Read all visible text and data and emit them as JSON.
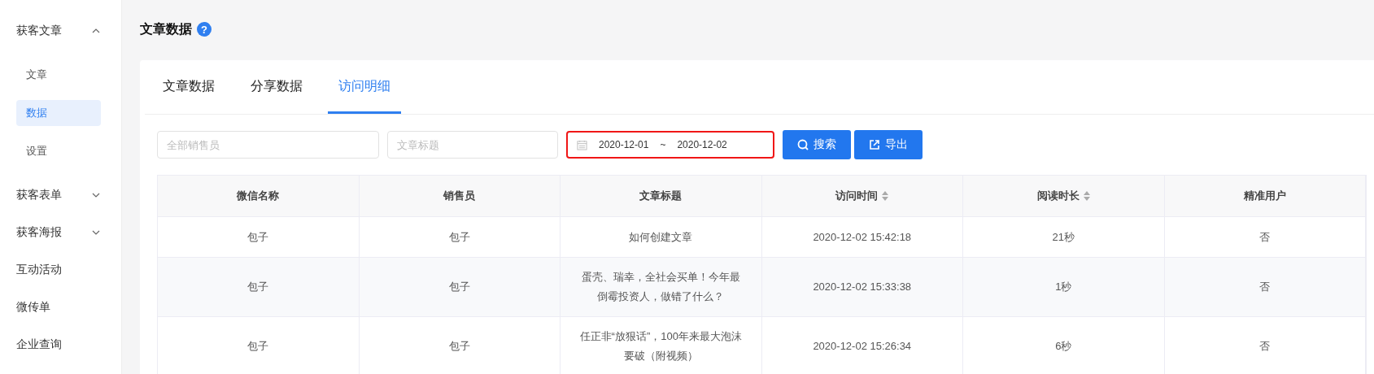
{
  "sidebar": {
    "items": [
      {
        "label": "获客文章",
        "expanded": true,
        "children": [
          {
            "label": "文章",
            "selected": false
          },
          {
            "label": "数据",
            "selected": true
          },
          {
            "label": "设置",
            "selected": false
          }
        ]
      },
      {
        "label": "获客表单",
        "expanded": false
      },
      {
        "label": "获客海报",
        "expanded": false
      },
      {
        "label": "互动活动"
      },
      {
        "label": "微传单"
      },
      {
        "label": "企业查询"
      }
    ]
  },
  "page": {
    "title": "文章数据",
    "help_icon": "?"
  },
  "tabs": [
    {
      "label": "文章数据",
      "selected": false
    },
    {
      "label": "分享数据",
      "selected": false
    },
    {
      "label": "访问明细",
      "selected": true
    }
  ],
  "filters": {
    "salesperson": {
      "placeholder": "全部销售员"
    },
    "article_title": {
      "placeholder": "文章标题"
    },
    "date_range": {
      "start": "2020-12-01",
      "separator": "~",
      "end": "2020-12-02",
      "highlighted": true
    },
    "search_button": "搜索",
    "export_button": "导出"
  },
  "table": {
    "columns": [
      {
        "label": "微信名称",
        "sortable": false
      },
      {
        "label": "销售员",
        "sortable": false
      },
      {
        "label": "文章标题",
        "sortable": false
      },
      {
        "label": "访问时间",
        "sortable": true
      },
      {
        "label": "阅读时长",
        "sortable": true
      },
      {
        "label": "精准用户",
        "sortable": false
      }
    ],
    "rows": [
      [
        "包子",
        "包子",
        "如何创建文章",
        "2020-12-02 15:42:18",
        "21秒",
        "否"
      ],
      [
        "包子",
        "包子",
        "蛋壳、瑞幸，全社会买单！今年最倒霉投资人，做错了什么？",
        "2020-12-02 15:33:38",
        "1秒",
        "否"
      ],
      [
        "包子",
        "包子",
        "任正非“放狠话”，100年来最大泡沫要破（附视频）",
        "2020-12-02 15:26:34",
        "6秒",
        "否"
      ]
    ]
  }
}
